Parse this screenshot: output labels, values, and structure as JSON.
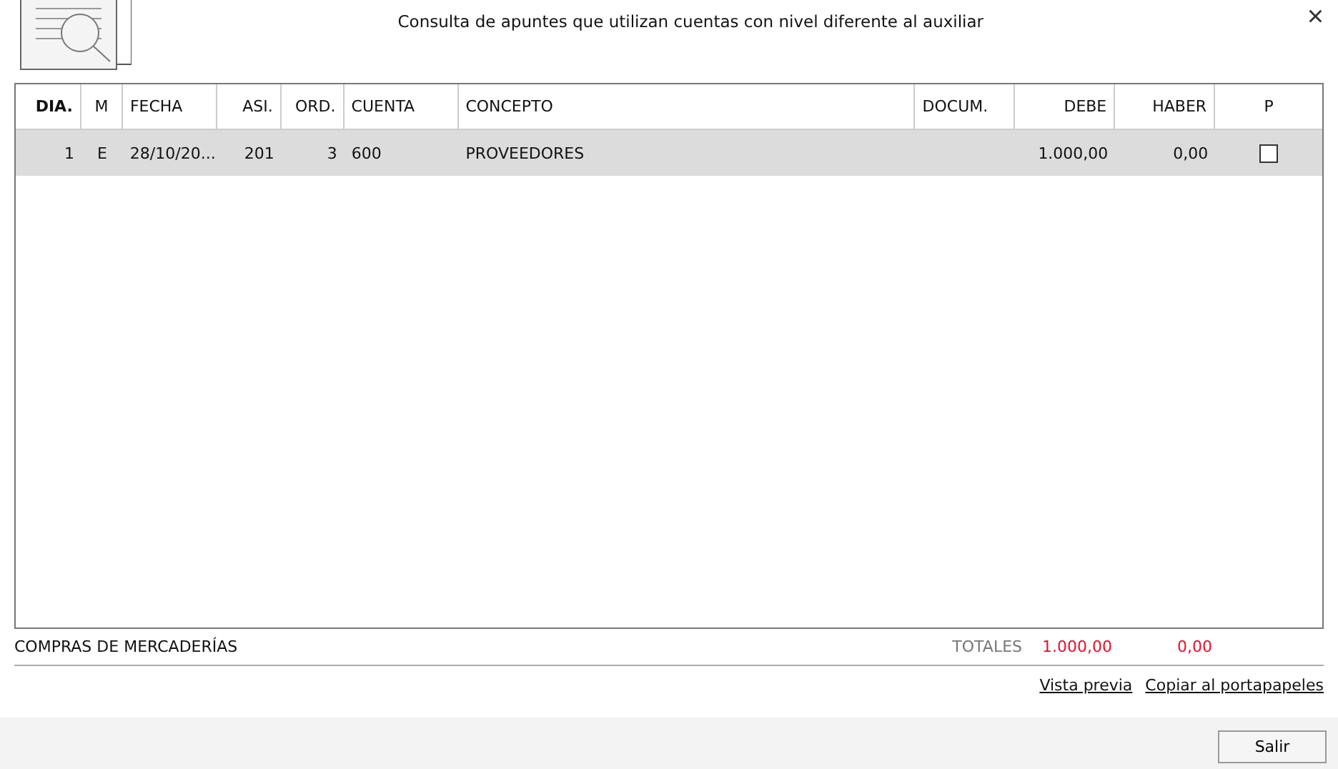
{
  "window": {
    "title": "Consulta de apuntes que utilizan cuentas con nivel diferente al auxiliar",
    "close": "×"
  },
  "table": {
    "columns": [
      "DIA.",
      "M",
      "FECHA",
      "ASI.",
      "ORD.",
      "CUENTA",
      "CONCEPTO",
      "DOCUM.",
      "DEBE",
      "HABER",
      "P"
    ],
    "rows": [
      {
        "selected": true,
        "cells": [
          "1",
          "E",
          "28/10/20...",
          "201",
          "3",
          "600",
          "PROVEEDORES",
          "",
          "1.000,00",
          "0,00"
        ],
        "checked": false
      }
    ]
  },
  "summary": {
    "account_name": "COMPRAS DE MERCADERÍAS",
    "totals_label": "TOTALES",
    "debe": "1.000,00",
    "haber": "0,00"
  },
  "links": [
    "Vista previa",
    "Copiar al portapapeles"
  ],
  "buttons": [
    "Salir"
  ]
}
